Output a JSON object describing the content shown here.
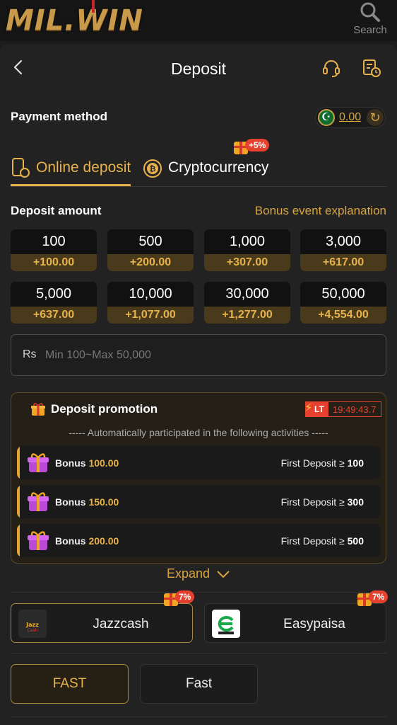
{
  "topbar": {
    "logo": "MIL.WIN",
    "search_label": "Search"
  },
  "header": {
    "title": "Deposit"
  },
  "payment_method": {
    "label": "Payment method",
    "balance": "0.00"
  },
  "tabs": [
    {
      "label": "Online deposit",
      "active": true
    },
    {
      "label": "Cryptocurrency",
      "badge": "+5%"
    }
  ],
  "deposit": {
    "label": "Deposit amount",
    "bonus_link": "Bonus event explanation",
    "amounts": [
      {
        "amount": "100",
        "bonus": "+100.00"
      },
      {
        "amount": "500",
        "bonus": "+200.00"
      },
      {
        "amount": "1,000",
        "bonus": "+307.00"
      },
      {
        "amount": "3,000",
        "bonus": "+617.00"
      },
      {
        "amount": "5,000",
        "bonus": "+637.00"
      },
      {
        "amount": "10,000",
        "bonus": "+1,077.00"
      },
      {
        "amount": "30,000",
        "bonus": "+1,277.00"
      },
      {
        "amount": "50,000",
        "bonus": "+4,554.00"
      }
    ],
    "currency": "Rs",
    "placeholder": "Min 100~Max 50,000"
  },
  "promotion": {
    "title": "Deposit promotion",
    "badge": "LT",
    "timer": "19:49:43.7",
    "subtitle": "----- Automatically participated in the following activities -----",
    "rows": [
      {
        "bonus_label": "Bonus",
        "bonus_value": "100.00",
        "cond_label": "First Deposit ≥",
        "cond_value": "100"
      },
      {
        "bonus_label": "Bonus",
        "bonus_value": "150.00",
        "cond_label": "First Deposit ≥",
        "cond_value": "300"
      },
      {
        "bonus_label": "Bonus",
        "bonus_value": "200.00",
        "cond_label": "First Deposit ≥",
        "cond_value": "500"
      }
    ],
    "expand": "Expand"
  },
  "payments": [
    {
      "label": "Jazzcash",
      "logo_text": "JazzCash",
      "badge": "7%",
      "selected": true
    },
    {
      "label": "Easypaisa",
      "badge": "7%",
      "selected": false
    }
  ],
  "channels": [
    {
      "label": "FAST",
      "selected": true
    },
    {
      "label": "Fast",
      "selected": false
    }
  ],
  "colors": {
    "accent": "#e7b24b",
    "background": "#222222",
    "badge": "#e6402e"
  }
}
